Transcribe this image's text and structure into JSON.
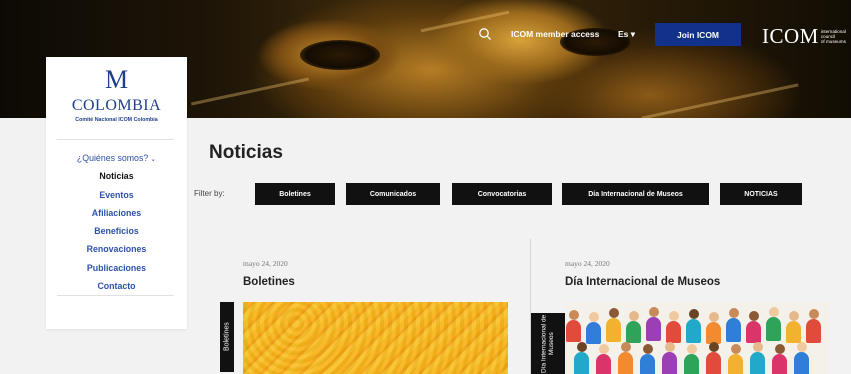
{
  "topbar": {
    "member_access": "ICOM member access",
    "language": "Es ▾",
    "join": "Join ICOM",
    "logo_main": "ICOM",
    "logo_line1": "international",
    "logo_line2": "council",
    "logo_line3": "of museums"
  },
  "sidebar": {
    "logo_mark": "M",
    "title": "COLOMBIA",
    "subtitle": "Comité Nacional ICOM Colombia",
    "items": [
      {
        "label": "¿Quiénes somos?",
        "chevron": "⌄"
      },
      {
        "label": "Noticias"
      },
      {
        "label": "Eventos"
      },
      {
        "label": "Afiliaciones"
      },
      {
        "label": "Beneficios"
      },
      {
        "label": "Renovaciones"
      },
      {
        "label": "Publicaciones"
      },
      {
        "label": "Contacto"
      }
    ]
  },
  "main": {
    "title": "Noticias",
    "filter_label": "Filter by:",
    "filters": [
      "Boletines",
      "Comunicados",
      "Convocatorias",
      "Día Internacional de Museos",
      "NOTICIAS"
    ]
  },
  "posts": [
    {
      "date": "mayo 24, 2020",
      "title": "Boletines",
      "category": "Boletines"
    },
    {
      "date": "mayo 24, 2020",
      "title": "Día Internacional de Museos",
      "category": "Día Internacional de Museos"
    }
  ],
  "colors": {
    "brand_blue": "#1f3f8c",
    "link_blue": "#2c52a8",
    "join_button": "#12318a",
    "filter_button": "#111111",
    "background": "#f2f2f2"
  }
}
